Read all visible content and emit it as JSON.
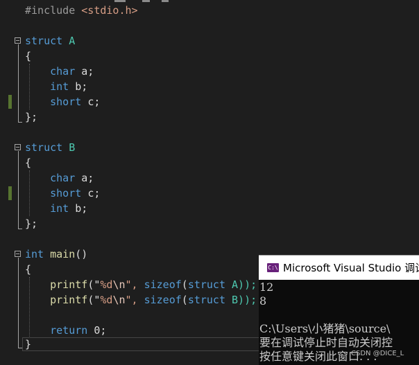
{
  "editor": {
    "include_directive": "#include",
    "include_file": "<stdio.h>",
    "struct_keyword": "struct",
    "struct_a_name": "A",
    "struct_b_name": "B",
    "open_brace": "{",
    "close_brace": "};",
    "main_close_brace": "}",
    "type_char": "char",
    "type_int": "int",
    "type_short": "short",
    "member_a": "a;",
    "member_b": "b;",
    "member_c": "c;",
    "main_return_type": "int",
    "main_func_name": "main",
    "main_parens": "()",
    "printf_name": "printf",
    "format_open": "(\"",
    "format_spec": "%d",
    "format_escape": "\\n",
    "format_close": "\",",
    "sizeof_keyword": "sizeof",
    "sizeof_open": "(",
    "sizeof_close_a": "A));",
    "sizeof_close_b": "B));",
    "return_keyword": "return",
    "return_value": "0;"
  },
  "console_window": {
    "icon_label": "C:\\",
    "title": "Microsoft Visual Studio 调试",
    "output_lines": [
      "12",
      "8",
      "",
      "C:\\Users\\小猪猪\\source\\",
      "要在调试停止时自动关闭控",
      "按任意键关闭此窗口. . ."
    ]
  },
  "watermark": "CSDN @DICE_L"
}
